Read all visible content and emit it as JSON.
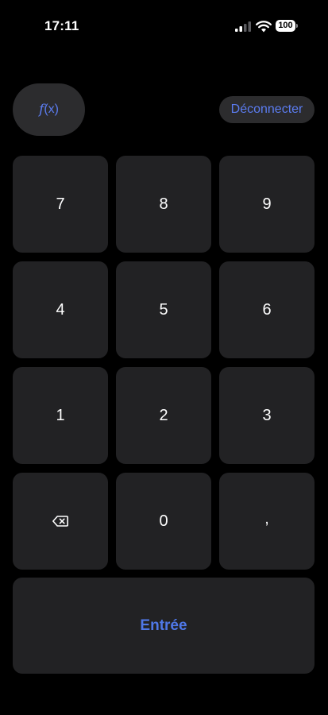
{
  "status_bar": {
    "time": "17:11",
    "battery_level": "100",
    "signal_icon": "cellular-signal-icon",
    "wifi_icon": "wifi-icon"
  },
  "header": {
    "fx_function": "f",
    "fx_argument": "(x)",
    "logout_label": "Déconnecter"
  },
  "keypad": {
    "keys": [
      "7",
      "8",
      "9",
      "4",
      "5",
      "6",
      "1",
      "2",
      "3",
      "⌫",
      "0",
      ","
    ],
    "backspace_icon": "backspace-icon"
  },
  "enter_label": "Entrée",
  "colors": {
    "background": "#000000",
    "key_background": "#222224",
    "accent": "#5b7cf0"
  }
}
